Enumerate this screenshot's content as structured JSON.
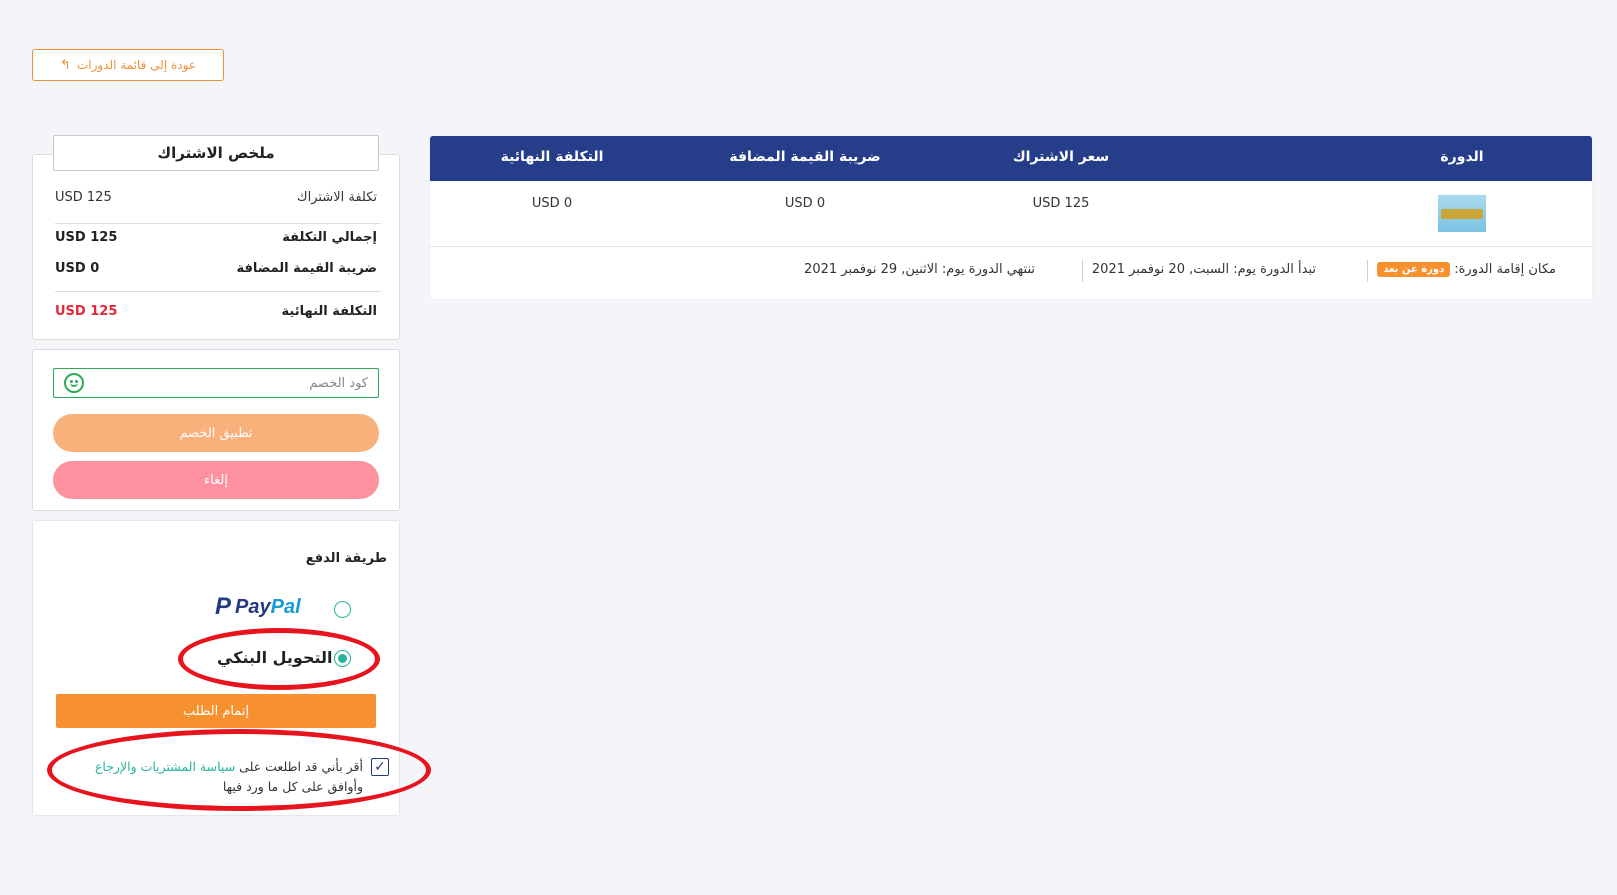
{
  "back_button": {
    "label": "عودة إلى قائمة الدورات",
    "icon": "reply-arrow-icon"
  },
  "summary": {
    "title": "ملخص الاشتراك",
    "rows": [
      {
        "label": "تكلفة الاشتراك",
        "value": "USD 125"
      },
      {
        "label": "إجمالي التكلفة",
        "value": "USD 125"
      },
      {
        "label": "ضريبة القيمة المضافة",
        "value": "USD 0"
      },
      {
        "label": "التكلفة النهائية",
        "value": "USD 125"
      }
    ]
  },
  "coupon": {
    "placeholder": "كود الخصم",
    "icon": "smile-icon",
    "apply_label": "تطبيق الخصم",
    "cancel_label": "إلغاء"
  },
  "payment": {
    "title": "طريقة الدفع",
    "paypal": {
      "pay": "Pay",
      "pal": "Pal",
      "selected": false
    },
    "bank_transfer": {
      "label": "التحويل البنكي",
      "selected": true
    },
    "submit_label": "إتمام الطلب",
    "terms": {
      "checked": true,
      "prefix": "أقر بأني قد اطلعت على",
      "link": "سياسة المشتريات والإرجاع",
      "suffix": "وأوافق على كل ما ورد فيها"
    }
  },
  "table": {
    "headers": [
      "الدورة",
      "سعر الاشتراك",
      "ضريبة القيمة المضافة",
      "التكلفة النهائية"
    ],
    "row": {
      "price": "USD 125",
      "vat": "USD 0",
      "final": "USD 0"
    },
    "info": {
      "location_label": "مكان إقامة الدورة:",
      "location_badge": "دورة عن بعد",
      "start": "تبدأ الدورة يوم: السبت, 20 نوفمبر 2021",
      "end": "تنتهي الدورة يوم: الاثنين, 29 نوفمبر 2021"
    }
  },
  "colors": {
    "primary": "#263e8a",
    "accent": "#f7902e",
    "success": "#28b49a",
    "danger": "#e2283b",
    "annotation": "#e8141d"
  }
}
